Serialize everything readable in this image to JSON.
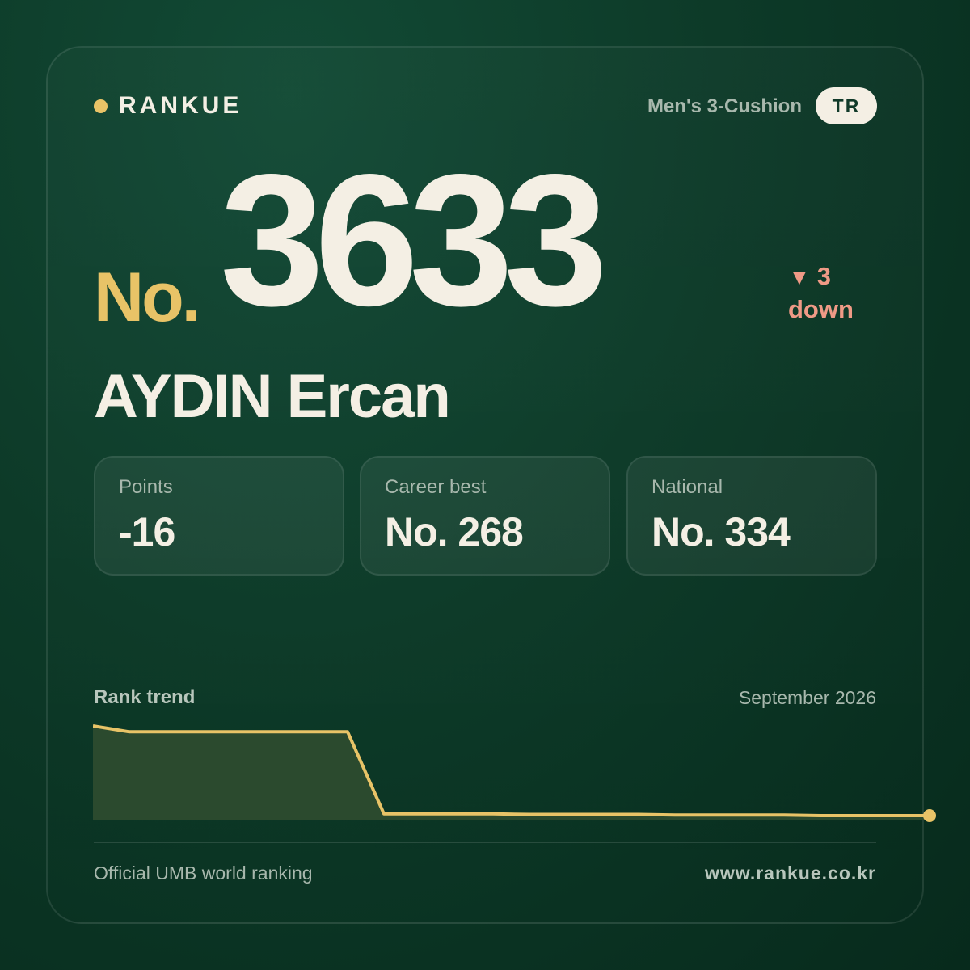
{
  "brand": {
    "name": "RANKUE",
    "dot_color": "#e8c367"
  },
  "header": {
    "category": "Men's 3-Cushion",
    "country_code": "TR"
  },
  "rank": {
    "prefix": "No.",
    "number": "3633",
    "change_symbol": "▼",
    "change_value": "3",
    "change_direction": "down",
    "change_color": "#ef9a86"
  },
  "player": {
    "name": "AYDIN Ercan"
  },
  "stats": [
    {
      "label": "Points",
      "value": "-16"
    },
    {
      "label": "Career best",
      "value": "No. 268"
    },
    {
      "label": "National",
      "value": "No. 334"
    }
  ],
  "trend": {
    "title": "Rank trend",
    "date": "September 2026"
  },
  "chart_data": {
    "type": "area",
    "title": "Rank trend",
    "line_color": "#e8c367",
    "fill_color": "#2b4a2e",
    "values": [
      3480,
      3490,
      3490,
      3490,
      3490,
      3490,
      3490,
      3490,
      3630,
      3630,
      3630,
      3630,
      3631,
      3631,
      3631,
      3631,
      3632,
      3632,
      3632,
      3632,
      3633,
      3633,
      3633,
      3633
    ],
    "y_inverted": true
  },
  "footer": {
    "source": "Official UMB world ranking",
    "url": "www.rankue.co.kr"
  }
}
